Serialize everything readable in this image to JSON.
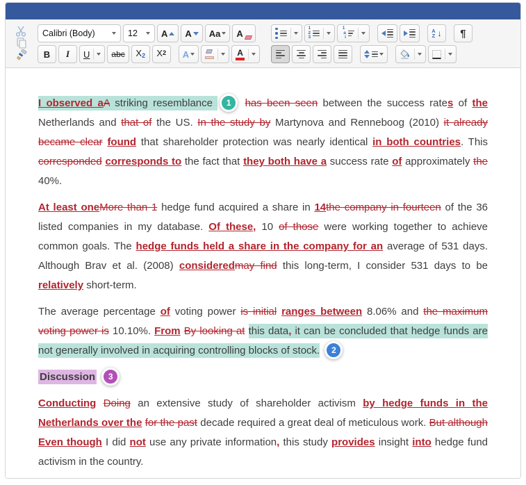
{
  "colors": {
    "titlebar": "#35599c",
    "accent_red": "#b2252e",
    "text_dark": "#3e3e3e",
    "teal_highlight": "#b9e3da",
    "teal_badge": "#33b5a2",
    "blue_badge": "#3c80d8",
    "purple_badge": "#b250b8",
    "purple_highlight": "#dfb5e3",
    "icon_blue": "#4a7ebb"
  },
  "toolbar": {
    "font_name": "Calibri (Body)",
    "font_size": "12",
    "glyphs": {
      "grow_font": "A",
      "shrink_font": "A",
      "change_case": "Aa",
      "clear_format": "A",
      "bold": "B",
      "italic": "I",
      "underline": "U",
      "strike": "abc",
      "sub_base": "X",
      "sub_digit": "2",
      "sup_base": "X",
      "sup_digit": "2",
      "text_effects": "A",
      "font_color": "A",
      "sort_a": "A",
      "sort_z": "Z",
      "sort_arrow": "↓",
      "pilcrow": "¶"
    }
  },
  "document": {
    "paragraphs": [
      {
        "kind": "para",
        "runs": [
          {
            "t": "ins",
            "text": "I observed a",
            "hl": "teal"
          },
          {
            "t": "del",
            "text": "A",
            "hl": "teal"
          },
          {
            "t": "normal",
            "text": " striking resemblance ",
            "hl": "teal"
          },
          {
            "t": "badge",
            "n": "1",
            "color": "teal"
          },
          {
            "t": "normal",
            "text": " "
          },
          {
            "t": "del",
            "text": "has been seen"
          },
          {
            "t": "normal",
            "text": " between the success rate"
          },
          {
            "t": "ins",
            "text": "s"
          },
          {
            "t": "normal",
            "text": " of "
          },
          {
            "t": "ins",
            "text": "the"
          },
          {
            "t": "normal",
            "text": " Netherlands and "
          },
          {
            "t": "del",
            "text": "that of"
          },
          {
            "t": "normal",
            "text": " the US. "
          },
          {
            "t": "del",
            "text": "In the study by"
          },
          {
            "t": "normal",
            "text": " Martynova and Renneboog (2010) "
          },
          {
            "t": "del",
            "text": "it already became clear"
          },
          {
            "t": "normal",
            "text": " "
          },
          {
            "t": "ins",
            "text": "found"
          },
          {
            "t": "normal",
            "text": " that shareholder protection was nearly identical "
          },
          {
            "t": "ins",
            "text": "in both countries"
          },
          {
            "t": "normal",
            "text": ". This "
          },
          {
            "t": "del",
            "text": "corresponded"
          },
          {
            "t": "normal",
            "text": " "
          },
          {
            "t": "ins",
            "text": "corresponds to"
          },
          {
            "t": "normal",
            "text": " the fact that "
          },
          {
            "t": "ins",
            "text": "they both have a"
          },
          {
            "t": "normal",
            "text": " success rate "
          },
          {
            "t": "ins",
            "text": "of"
          },
          {
            "t": "normal",
            "text": " approximately "
          },
          {
            "t": "del",
            "text": "the"
          },
          {
            "t": "normal",
            "text": " 40%."
          }
        ]
      },
      {
        "kind": "para",
        "runs": [
          {
            "t": "ins",
            "text": "At least one"
          },
          {
            "t": "del",
            "text": "More than 1"
          },
          {
            "t": "normal",
            "text": " hedge fund acquired a share in "
          },
          {
            "t": "ins",
            "text": "14"
          },
          {
            "t": "del",
            "text": "the company in fourteen"
          },
          {
            "t": "normal",
            "text": " of the 36 listed companies in my database. "
          },
          {
            "t": "ins",
            "text": "Of these,"
          },
          {
            "t": "normal",
            "text": " 10 "
          },
          {
            "t": "del",
            "text": "of those"
          },
          {
            "t": "normal",
            "text": " were working together to achieve common goals. The "
          },
          {
            "t": "ins",
            "text": "hedge funds held a share in the company for an"
          },
          {
            "t": "normal",
            "text": " average of 531 days. Although Brav et al. (2008) "
          },
          {
            "t": "ins",
            "text": "considered"
          },
          {
            "t": "del",
            "text": "may find"
          },
          {
            "t": "normal",
            "text": " this long-term, I consider 531 days to be "
          },
          {
            "t": "ins",
            "text": "relatively"
          },
          {
            "t": "normal",
            "text": " short-term."
          }
        ]
      },
      {
        "kind": "para",
        "runs": [
          {
            "t": "normal",
            "text": "The average percentage "
          },
          {
            "t": "ins",
            "text": "of"
          },
          {
            "t": "normal",
            "text": " voting power "
          },
          {
            "t": "del",
            "text": "is initial"
          },
          {
            "t": "normal",
            "text": " "
          },
          {
            "t": "ins",
            "text": "ranges between"
          },
          {
            "t": "normal",
            "text": " 8.06% and "
          },
          {
            "t": "del",
            "text": "the maximum voting power is"
          },
          {
            "t": "normal",
            "text": " 10.10%. "
          },
          {
            "t": "ins",
            "text": "From"
          },
          {
            "t": "normal",
            "text": " "
          },
          {
            "t": "del",
            "text": "By looking at"
          },
          {
            "t": "normal",
            "text": " "
          },
          {
            "t": "normal",
            "text": "this data",
            "hl": "teal"
          },
          {
            "t": "ins",
            "text": ",",
            "hl": "teal"
          },
          {
            "t": "normal",
            "text": " it can be concluded that hedge funds are not generally involved in acquiring controlling blocks of stock.",
            "hl": "teal"
          },
          {
            "t": "normal",
            "text": " "
          },
          {
            "t": "badge",
            "n": "2",
            "color": "blue"
          }
        ]
      },
      {
        "kind": "heading",
        "runs": [
          {
            "t": "normal",
            "text": "Discussion",
            "hl": "purple"
          },
          {
            "t": "normal",
            "text": " "
          },
          {
            "t": "badge",
            "n": "3",
            "color": "purple"
          }
        ]
      },
      {
        "kind": "para",
        "runs": [
          {
            "t": "ins",
            "text": "Conducting"
          },
          {
            "t": "normal",
            "text": " "
          },
          {
            "t": "del",
            "text": "Doing"
          },
          {
            "t": "normal",
            "text": " an extensive study of shareholder activism "
          },
          {
            "t": "ins",
            "text": "by hedge funds in the Netherlands over the"
          },
          {
            "t": "normal",
            "text": " "
          },
          {
            "t": "del",
            "text": "for the past"
          },
          {
            "t": "normal",
            "text": " decade required a great deal of meticulous work. "
          },
          {
            "t": "del",
            "text": "But although"
          },
          {
            "t": "normal",
            "text": " "
          },
          {
            "t": "ins",
            "text": "Even though"
          },
          {
            "t": "normal",
            "text": " I did "
          },
          {
            "t": "ins",
            "text": "not"
          },
          {
            "t": "normal",
            "text": " use any private information"
          },
          {
            "t": "ins",
            "text": ","
          },
          {
            "t": "normal",
            "text": " this study "
          },
          {
            "t": "ins",
            "text": "provides"
          },
          {
            "t": "normal",
            "text": " insight "
          },
          {
            "t": "ins",
            "text": "into"
          },
          {
            "t": "normal",
            "text": " hedge fund activism in the country."
          }
        ]
      }
    ]
  }
}
